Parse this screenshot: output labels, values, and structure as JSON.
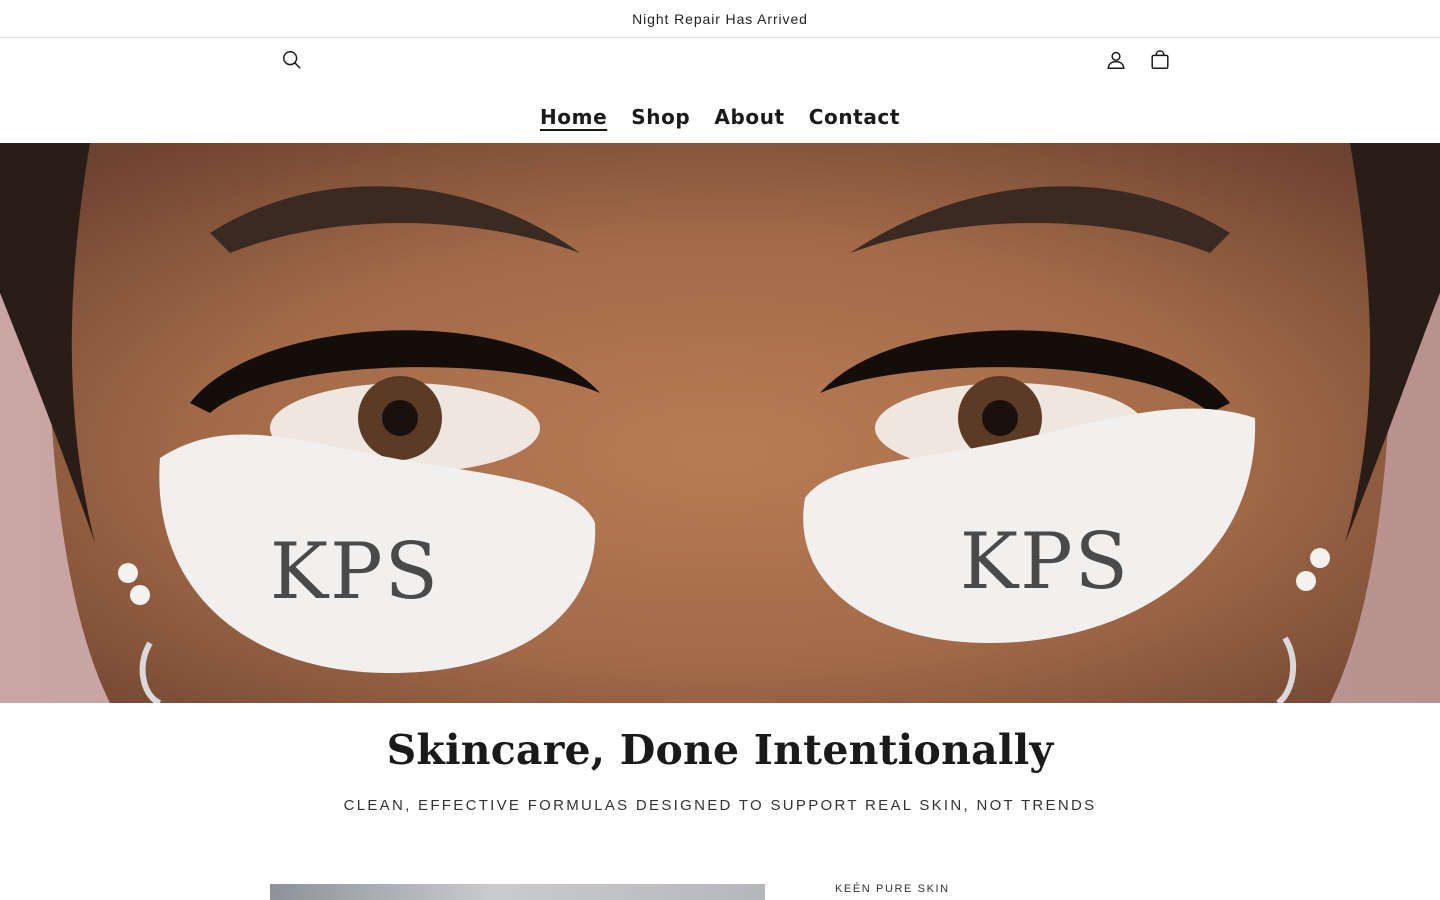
{
  "announcement": {
    "text": "Night Repair Has Arrived"
  },
  "header": {
    "icons": {
      "search": "search-icon",
      "account": "account-icon",
      "cart": "cart-icon"
    }
  },
  "nav": {
    "items": [
      {
        "label": "Home",
        "active": true
      },
      {
        "label": "Shop",
        "active": false
      },
      {
        "label": "About",
        "active": false
      },
      {
        "label": "Contact",
        "active": false
      }
    ]
  },
  "hero": {
    "patch_text": "KPS",
    "patch_subtext": "KEÉN PURE SKIN"
  },
  "intro": {
    "headline": "Skincare, Done Intentionally",
    "subhead": "CLEAN, EFFECTIVE FORMULAS DESIGNED TO SUPPORT REAL SKIN, NOT TRENDS"
  },
  "featured": {
    "brand": "KEÉN PURE SKIN"
  },
  "colors": {
    "text": "#1a1a1a",
    "background": "#ffffff",
    "divider": "#e6e6e6"
  }
}
